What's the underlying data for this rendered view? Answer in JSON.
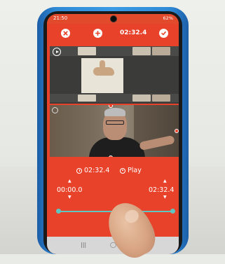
{
  "status_bar": {
    "time": "21:50",
    "right": "62%"
  },
  "toolbar": {
    "time": "02:32.4"
  },
  "controls": {
    "duration": "02:32.4",
    "play_label": "Play",
    "start_time": "00:00.0",
    "end_time": "02:32.4"
  },
  "icons": {
    "close": "close-icon",
    "add": "plus-icon",
    "confirm": "check-icon",
    "clock": "clock-icon",
    "play": "play-icon"
  },
  "colors": {
    "app_accent": "#e8432a",
    "trim_track": "#5ec6c0",
    "phone_case": "#2f8ad6"
  }
}
